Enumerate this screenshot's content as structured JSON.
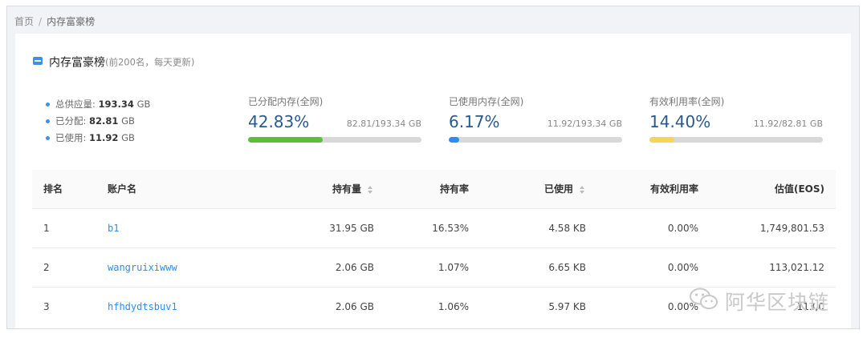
{
  "breadcrumb": {
    "home": "首页",
    "separator": "/",
    "current": "内存富豪榜"
  },
  "header": {
    "title": "内存富豪榜",
    "subtitle": "(前200名，每天更新)",
    "icon": "list-icon"
  },
  "summary": [
    {
      "label": "总供应量:",
      "value": "193.34",
      "unit": "GB"
    },
    {
      "label": "已分配:",
      "value": "82.81",
      "unit": "GB"
    },
    {
      "label": "已使用:",
      "value": "11.92",
      "unit": "GB"
    }
  ],
  "stats": [
    {
      "label": "已分配内存(全网)",
      "percent": "42.83%",
      "ratio": "82.81/193.34 GB",
      "fill": 0.4283,
      "color": "#5cbf3a"
    },
    {
      "label": "已使用内存(全网)",
      "percent": "6.17%",
      "ratio": "11.92/193.34 GB",
      "fill": 0.0617,
      "color": "#2d8cf0"
    },
    {
      "label": "有效利用率(全网)",
      "percent": "14.40%",
      "ratio": "11.92/82.81 GB",
      "fill": 0.144,
      "color": "#f7d358"
    }
  ],
  "table": {
    "headers": [
      "排名",
      "账户名",
      "持有量",
      "持有率",
      "已使用",
      "有效利用率",
      "估值(EOS)"
    ],
    "rows": [
      [
        "1",
        "b1",
        "31.95 GB",
        "16.53%",
        "4.58 KB",
        "0.00%",
        "1,749,801.53"
      ],
      [
        "2",
        "wangruixiwww",
        "2.06 GB",
        "1.07%",
        "6.65 KB",
        "0.00%",
        "113,021.12"
      ],
      [
        "3",
        "hfhdydtsbuv1",
        "2.06 GB",
        "1.06%",
        "5.97 KB",
        "0.00%",
        "113,0"
      ]
    ]
  },
  "watermark": {
    "text": "阿华区块链",
    "icon": "wechat-icon"
  }
}
